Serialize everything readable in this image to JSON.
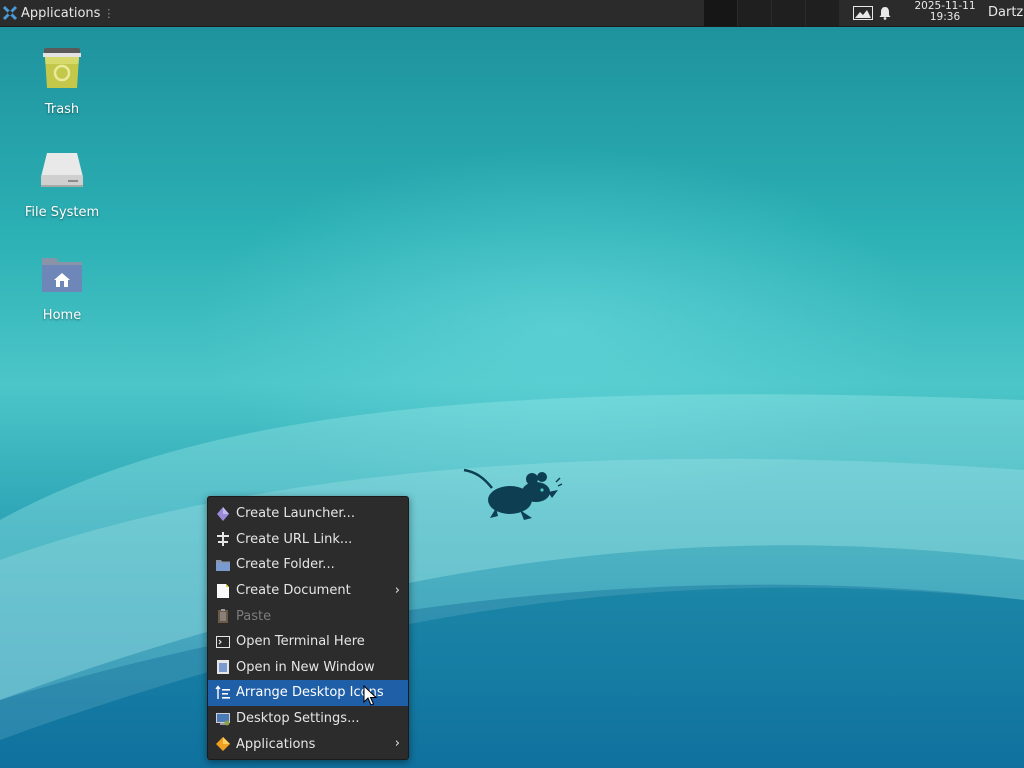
{
  "panel": {
    "apps_label": "Applications",
    "clock_date": "2025-11-11",
    "clock_time": "19:36",
    "user": "Dartz",
    "workspaces_count": 4,
    "active_workspace": 1
  },
  "desktop": {
    "icons": [
      {
        "label": "Trash",
        "icon": "trash-icon"
      },
      {
        "label": "File System",
        "icon": "drive-icon"
      },
      {
        "label": "Home",
        "icon": "home-folder-icon"
      }
    ]
  },
  "context_menu": {
    "items": [
      {
        "label": "Create Launcher...",
        "icon": "launcher-icon",
        "submenu": false,
        "disabled": false
      },
      {
        "label": "Create URL Link...",
        "icon": "link-icon",
        "submenu": false,
        "disabled": false
      },
      {
        "label": "Create Folder...",
        "icon": "folder-icon",
        "submenu": false,
        "disabled": false
      },
      {
        "label": "Create Document",
        "icon": "document-icon",
        "submenu": true,
        "disabled": false
      },
      {
        "label": "Paste",
        "icon": "paste-icon",
        "submenu": false,
        "disabled": true
      },
      {
        "label": "Open Terminal Here",
        "icon": "terminal-icon",
        "submenu": false,
        "disabled": false
      },
      {
        "label": "Open in New Window",
        "icon": "window-icon",
        "submenu": false,
        "disabled": false
      },
      {
        "label": "Arrange Desktop Icons",
        "icon": "arrange-icon",
        "submenu": false,
        "disabled": false,
        "highlighted": true
      },
      {
        "label": "Desktop Settings...",
        "icon": "desktop-settings-icon",
        "submenu": false,
        "disabled": false
      },
      {
        "label": "Applications",
        "icon": "applications-icon",
        "submenu": true,
        "disabled": false
      }
    ],
    "submenu_arrow": "›"
  },
  "colors": {
    "panel_bg": "#2b2b2b",
    "menu_bg": "#2c2c2c",
    "menu_highlight": "#1f5fa8",
    "desktop_teal": "#2bb0b4"
  }
}
